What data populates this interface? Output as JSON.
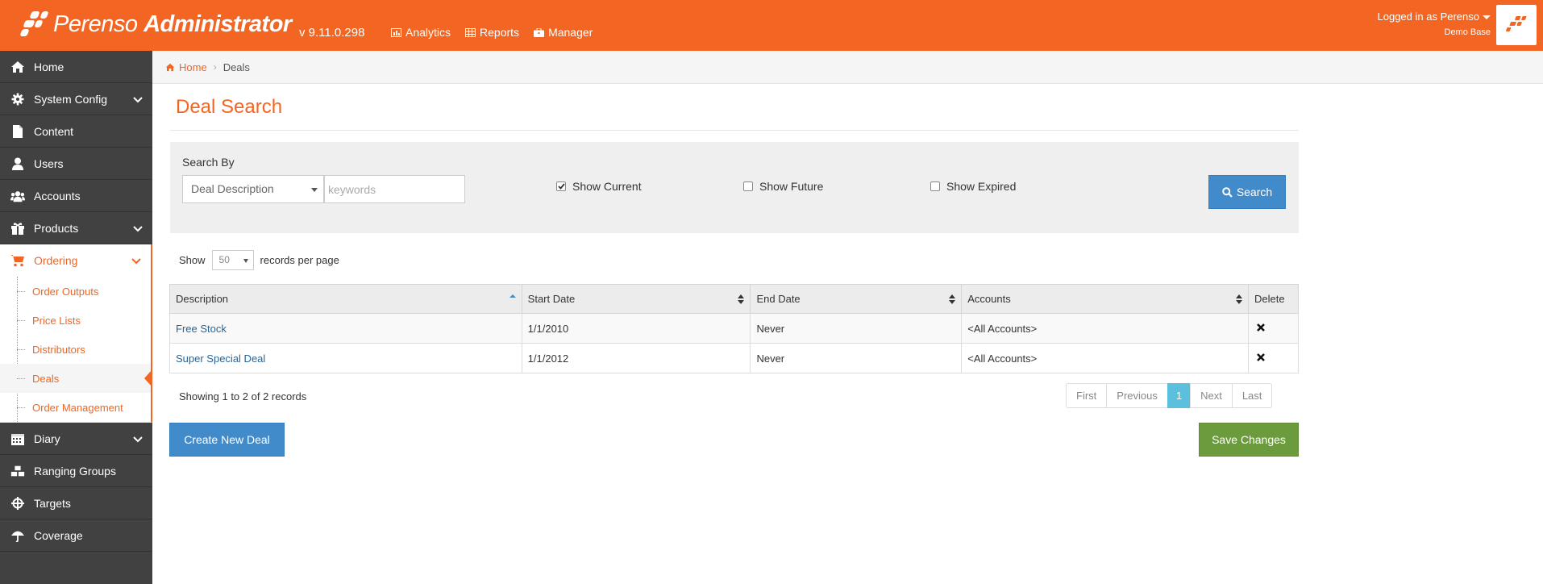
{
  "header": {
    "brand_light": "Perenso",
    "brand_bold": "Administrator",
    "version": "v 9.11.0.298",
    "nav": [
      {
        "label": "Analytics",
        "icon": "chart-icon"
      },
      {
        "label": "Reports",
        "icon": "table-icon"
      },
      {
        "label": "Manager",
        "icon": "briefcase-icon"
      }
    ],
    "user_line1": "Logged in as Perenso",
    "user_line2": "Demo Base"
  },
  "sidebar": {
    "items": [
      {
        "label": "Home",
        "icon": "home-icon"
      },
      {
        "label": "System Config",
        "icon": "gear-icon"
      },
      {
        "label": "Content",
        "icon": "file-icon"
      },
      {
        "label": "Users",
        "icon": "user-icon"
      },
      {
        "label": "Accounts",
        "icon": "group-icon"
      },
      {
        "label": "Products",
        "icon": "gift-icon"
      },
      {
        "label": "Ordering",
        "icon": "cart-icon"
      },
      {
        "label": "Diary",
        "icon": "calendar-icon"
      },
      {
        "label": "Ranging Groups",
        "icon": "cubes-icon"
      },
      {
        "label": "Targets",
        "icon": "crosshairs-icon"
      },
      {
        "label": "Coverage",
        "icon": "umbrella-icon"
      }
    ],
    "ordering_sub": [
      {
        "label": "Order Outputs"
      },
      {
        "label": "Price Lists"
      },
      {
        "label": "Distributors"
      },
      {
        "label": "Deals"
      },
      {
        "label": "Order Management"
      }
    ]
  },
  "breadcrumb": {
    "home": "Home",
    "current": "Deals"
  },
  "page": {
    "title": "Deal Search"
  },
  "search": {
    "label": "Search By",
    "field": "Deal Description",
    "placeholder": "keywords",
    "show_current": "Show Current",
    "show_future": "Show Future",
    "show_expired": "Show Expired",
    "show_current_checked": true,
    "show_future_checked": false,
    "show_expired_checked": false,
    "button": "Search"
  },
  "records": {
    "show": "Show",
    "per_page_value": "50",
    "per_page_label": "records per page"
  },
  "table": {
    "headers": [
      "Description",
      "Start Date",
      "End Date",
      "Accounts",
      "Delete"
    ],
    "rows": [
      {
        "description": "Free Stock",
        "start": "1/1/2010",
        "end": "Never",
        "accounts": "<All Accounts>"
      },
      {
        "description": "Super Special Deal",
        "start": "1/1/2012",
        "end": "Never",
        "accounts": "<All Accounts>"
      }
    ]
  },
  "footer": {
    "showing": "Showing 1 to 2 of 2 records",
    "pager": [
      "First",
      "Previous",
      "1",
      "Next",
      "Last"
    ],
    "create_button": "Create New Deal",
    "save_button": "Save Changes"
  },
  "colors": {
    "brand": "#f26522",
    "sidebar": "#414141",
    "primary": "#428bca",
    "success": "#6c9b3e",
    "pager_active": "#5bc0de"
  }
}
